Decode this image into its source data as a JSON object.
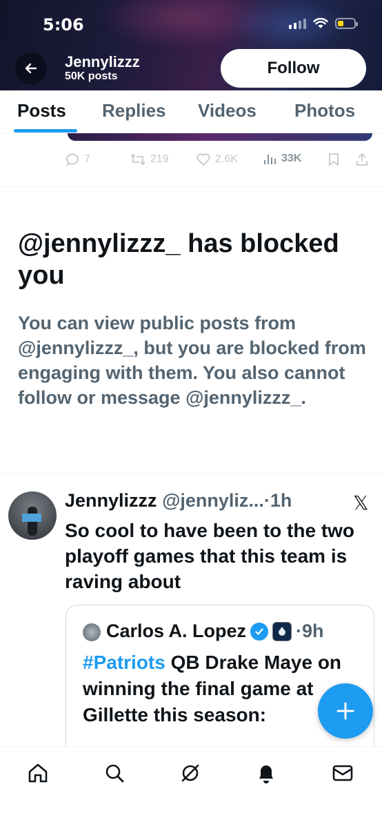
{
  "status_bar": {
    "time": "5:06"
  },
  "header": {
    "name": "Jennylizzz",
    "posts_count": "50K posts",
    "follow_label": "Follow"
  },
  "tabs": [
    {
      "label": "Posts",
      "active": true
    },
    {
      "label": "Replies",
      "active": false
    },
    {
      "label": "Videos",
      "active": false
    },
    {
      "label": "Photos",
      "active": false
    }
  ],
  "previous_post": {
    "replies": "7",
    "reposts": "219",
    "likes": "2.6K",
    "views": "33K"
  },
  "blocked_notice": {
    "title": "@jennylizzz_ has blocked you",
    "body": "You can view public posts from @jennylizzz_, but you are blocked from engaging with them. You also cannot follow or message @jennylizzz_."
  },
  "tweet": {
    "name": "Jennylizzz",
    "handle": "@jennyliz...",
    "time": "·1h",
    "text": "So cool to have been to the two playoff games that this team is raving about",
    "quote": {
      "name": "Carlos A. Lopez",
      "time": "·9h",
      "hashtag": "#Patriots",
      "text_rest": " QB Drake Maye on winning the final game at Gillette this season:"
    }
  },
  "colors": {
    "accent": "#1d9bf0",
    "secondary_text": "#536471",
    "primary_text": "#0f1419"
  },
  "icons": {
    "back": "arrow-left-icon",
    "more": "x-logo-icon",
    "compose": "plus-icon",
    "nav": [
      "home-icon",
      "search-icon",
      "grok-icon",
      "notifications-icon",
      "messages-icon"
    ]
  }
}
